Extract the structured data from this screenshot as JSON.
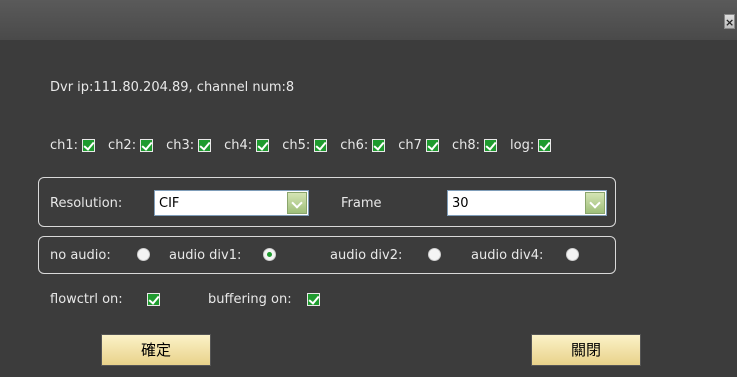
{
  "titlebar": {
    "close_glyph": "×"
  },
  "info": {
    "text": "Dvr ip:111.80.204.89, channel num:8"
  },
  "channels": [
    {
      "label": "ch1:",
      "checked": true
    },
    {
      "label": "ch2:",
      "checked": true
    },
    {
      "label": "ch3:",
      "checked": true
    },
    {
      "label": "ch4:",
      "checked": true
    },
    {
      "label": "ch5:",
      "checked": true
    },
    {
      "label": "ch6:",
      "checked": true
    },
    {
      "label": "ch7",
      "checked": true
    },
    {
      "label": "ch8:",
      "checked": true
    },
    {
      "label": "log:",
      "checked": true
    }
  ],
  "video": {
    "resolution_label": "Resolution:",
    "resolution_value": "CIF",
    "frame_label": "Frame",
    "frame_value": "30"
  },
  "audio": {
    "no_audio_label": "no audio:",
    "div1_label": "audio div1:",
    "div2_label": "audio div2:",
    "div4_label": "audio div4:",
    "selected": "audio div1"
  },
  "options": {
    "flowctrl_label": "flowctrl on:",
    "buffering_label": "buffering on:"
  },
  "buttons": {
    "ok_label": "確定",
    "close_label": "關閉"
  },
  "colors": {
    "check_green": "#1e9a2e",
    "dialog_bg": "#3c3c3c",
    "button_face": "#f3e3a8"
  }
}
